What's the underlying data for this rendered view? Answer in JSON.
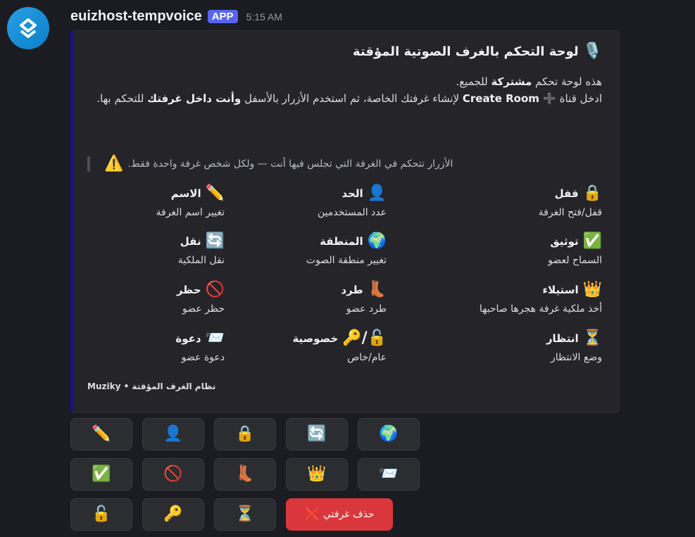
{
  "message": {
    "username": "euizhost-tempvoice",
    "badge": "APP",
    "timestamp": "5:15 AM"
  },
  "embed": {
    "title_icon": "🎙️",
    "title": "لوحة التحكم بالغرف الصوتية المؤقتة",
    "desc_line1_a": "هذه لوحة تحكم ",
    "desc_line1_b": "مشتركة",
    "desc_line1_c": " للجميع.",
    "desc_line2_a": "ادخل قناة ",
    "desc_line2_icon": "➕",
    "desc_line2_b": " Create Room",
    "desc_line2_c": " لإنشاء غرفتك الخاصة، ثم استخدم الأزرار بالأسفل ",
    "desc_line2_d": "وأنت داخل غرفتك",
    "desc_line2_e": " للتحكم بها.",
    "quote_icon": "⚠️",
    "quote_text": "الأزرار تتحكم في الغرفة التي تجلس فيها أنت — ولكل شخص غرفة واحدة فقط.",
    "fields": [
      {
        "icon": "🔒",
        "name": "قفل",
        "value": "قفل/فتح الغرفة"
      },
      {
        "icon": "👤",
        "name": "الحد",
        "value": "عدد المستخدمين"
      },
      {
        "icon": "✏️",
        "name": "الاسم",
        "value": "تغيير اسم الغرفة"
      },
      {
        "icon": "✅",
        "name": "توثيق",
        "value": "السماح لعضو"
      },
      {
        "icon": "🌍",
        "name": "المنطقة",
        "value": "تغيير منطقة الصوت"
      },
      {
        "icon": "🔄",
        "name": "نقل",
        "value": "نقل الملكية"
      },
      {
        "icon": "👑",
        "name": "استيلاء",
        "value": "أخذ ملكية غرفة هجرها صاحبها"
      },
      {
        "icon": "👢",
        "name": "طرد",
        "value": "طرد عضو"
      },
      {
        "icon": "🚫",
        "name": "حظر",
        "value": "حظر عضو"
      },
      {
        "icon": "⏳",
        "name": "انتظار",
        "value": "وضع الانتظار"
      },
      {
        "icon": "🔓/🔑",
        "name": "خصوصية",
        "value": "عام/خاص"
      },
      {
        "icon": "📨",
        "name": "دعوة",
        "value": "دعوة عضو"
      }
    ],
    "footer": "Muziky • نظام الغرف المؤقتة"
  },
  "buttons": {
    "rename": "✏️",
    "limit": "👤",
    "lock": "🔒",
    "transfer": "🔄",
    "region": "🌍",
    "permit": "✅",
    "ban": "🚫",
    "kick": "👢",
    "claim": "👑",
    "invite": "📨",
    "unlock": "🔓",
    "privacy": "🔑",
    "waiting": "⏳",
    "delete_icon": "❌",
    "delete_label": "حذف غرفتي"
  }
}
